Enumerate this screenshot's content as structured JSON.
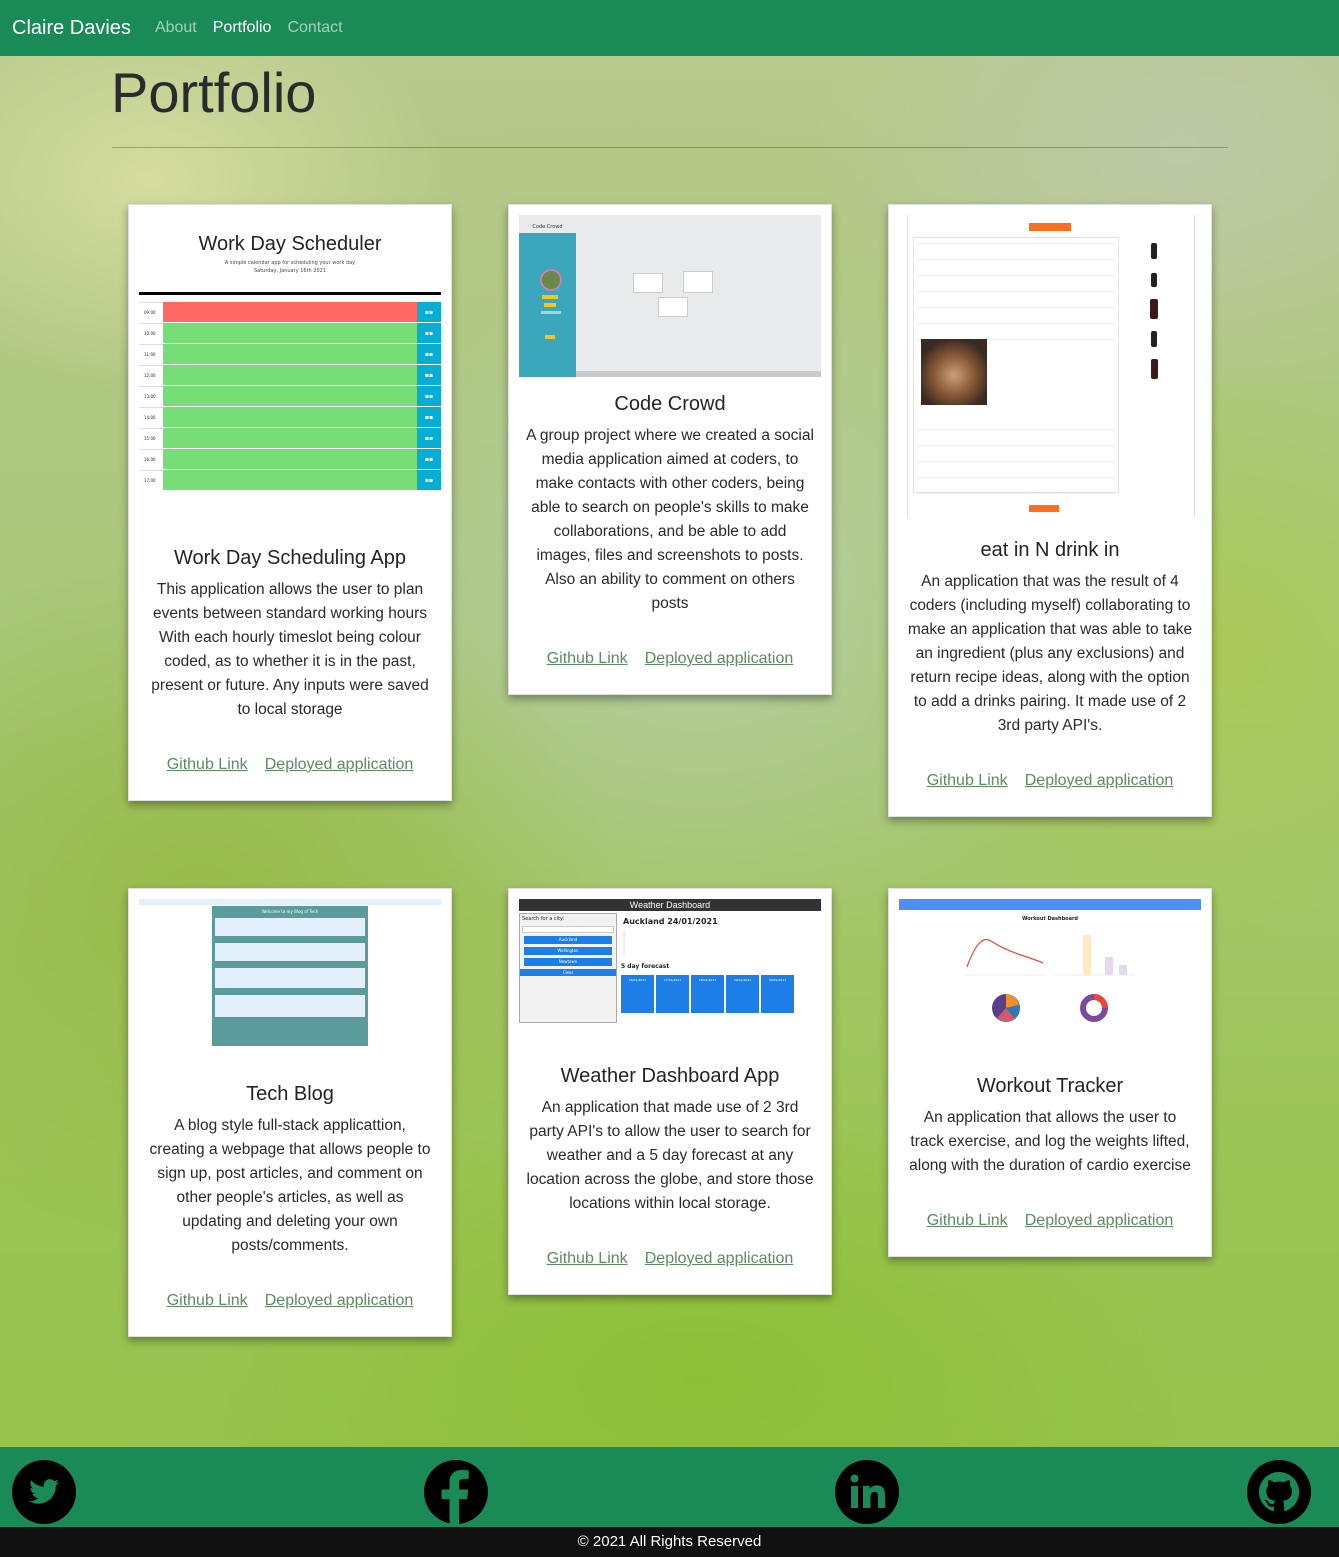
{
  "navbar": {
    "brand": "Claire Davies",
    "links": [
      {
        "label": "About",
        "active": false
      },
      {
        "label": "Portfolio",
        "active": true
      },
      {
        "label": "Contact",
        "active": false
      }
    ]
  },
  "page": {
    "title": "Portfolio"
  },
  "projects": [
    {
      "title": "Work Day Scheduling App",
      "description": "This application allows the user to plan events between standard working hours With each hourly timeslot being colour coded, as to whether it is in the past, present or future. Any inputs were saved to local storage",
      "github_label": "Github Link",
      "deployed_label": "Deployed application",
      "thumb": {
        "heading": "Work Day Scheduler",
        "sub1": "A simple calendar app for scheduling your work day",
        "sub2": "Saturday, January 16th 2021",
        "hours": [
          "09:00",
          "10:00",
          "11:00",
          "12:00",
          "13:00",
          "14:00",
          "15:00",
          "16:00",
          "17:00"
        ]
      }
    },
    {
      "title": "Code Crowd",
      "description": "A group project where we created a social media application aimed at coders, to make contacts with other coders, being able to search on people's skills to make collaborations, and be able to add images, files and screenshots to posts. Also an ability to comment on others posts",
      "github_label": "Github Link",
      "deployed_label": "Deployed application",
      "thumb": {
        "logo": "Code Crowd"
      }
    },
    {
      "title": "eat in N drink in",
      "description": "An application that was the result of 4 coders (including myself) collaborating to make an application that was able to take an ingredient (plus any exclusions) and return recipe ideas, along with the option to add a drinks pairing. It made use of 2 3rd party API's.",
      "github_label": "Github Link",
      "deployed_label": "Deployed application"
    },
    {
      "title": "Tech Blog",
      "description": "A blog style full-stack applicattion, creating a webpage that allows people to sign up, post articles, and comment on other people's articles, as well as updating and deleting your own posts/comments.",
      "github_label": "Github Link",
      "deployed_label": "Deployed application",
      "thumb": {
        "banner": "Welcome to my Blog of Tech"
      }
    },
    {
      "title": "Weather Dashboard App",
      "description": "An application that made use of 2 3rd party API's to allow the user to search for weather and a 5 day forecast at any location across the globe, and store those locations within local storage.",
      "github_label": "Github Link",
      "deployed_label": "Deployed application",
      "thumb": {
        "header": "Weather Dashboard",
        "search_label": "Search for a city:",
        "city_date": "Auckland 24/01/2021",
        "forecast_label": "5 day forecast",
        "cities": [
          "Auckland",
          "Wellington",
          "Newtown"
        ],
        "clear_label": "Clear",
        "forecast_dates": [
          "26/01/2021",
          "27/01/2021",
          "28/01/2021",
          "29/01/2021",
          "30/01/2021"
        ]
      }
    },
    {
      "title": "Workout Tracker",
      "description": "An application that allows the user to track exercise, and log the weights lifted, along with the duration of cardio exercise",
      "github_label": "Github Link",
      "deployed_label": "Deployed application",
      "thumb": {
        "heading": "Workout Dashboard"
      }
    }
  ],
  "footer": {
    "icons": [
      "twitter-icon",
      "facebook-icon",
      "linkedin-icon",
      "github-icon"
    ],
    "copyright": "© 2021 All Rights Reserved"
  },
  "colors": {
    "nav_green": "#1a8a57",
    "link_green": "#5d8a63",
    "past_red": "#ff6961",
    "future_green": "#77dd77",
    "save_blue": "#06aed5"
  }
}
